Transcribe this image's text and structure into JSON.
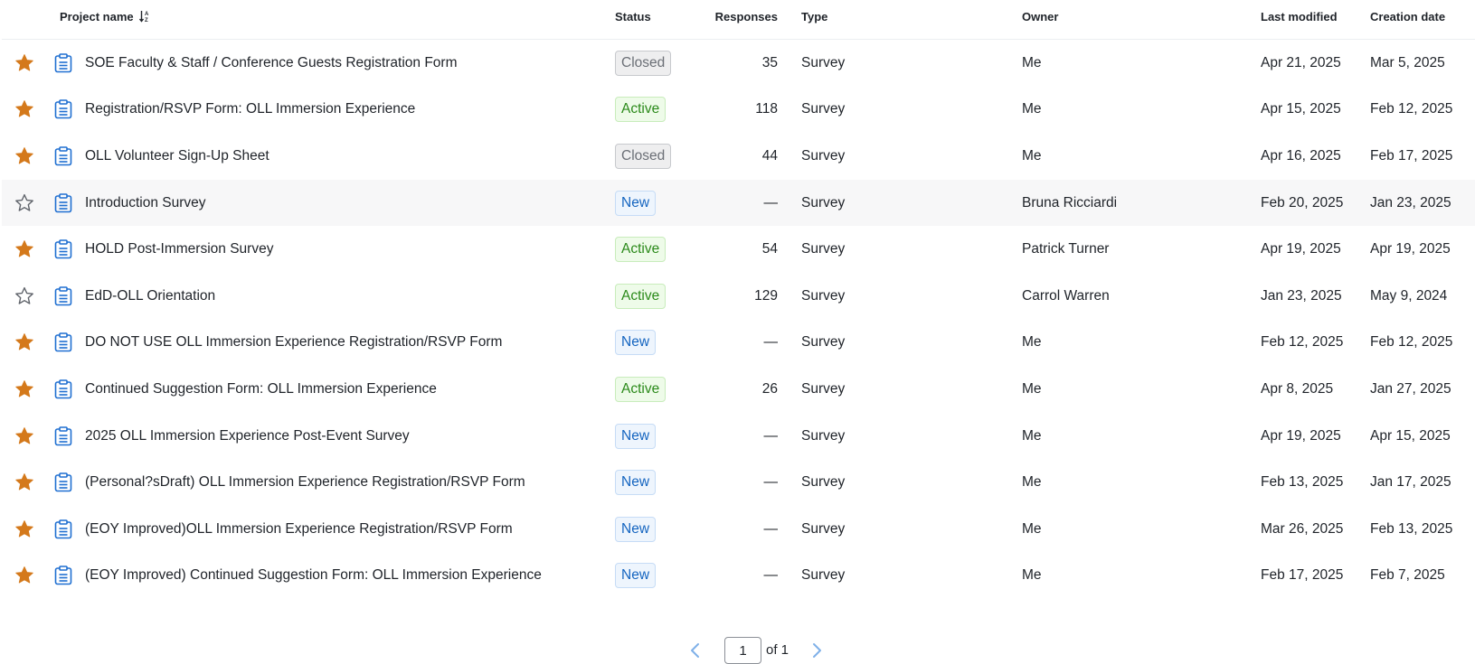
{
  "columns": {
    "project_name": "Project name",
    "status": "Status",
    "responses": "Responses",
    "type": "Type",
    "owner": "Owner",
    "last_modified": "Last modified",
    "creation_date": "Creation date"
  },
  "colors": {
    "star_filled": "#d4791b",
    "star_outline": "#5f636a",
    "doc_icon": "#1f6fd1",
    "pager_arrow": "#7fb0e8"
  },
  "rows": [
    {
      "starred": true,
      "name": "SOE Faculty & Staff / Conference Guests Registration Form",
      "status": "Closed",
      "responses": "35",
      "type": "Survey",
      "owner": "Me",
      "last_modified": "Apr 21, 2025",
      "created": "Mar 5, 2025"
    },
    {
      "starred": true,
      "name": "Registration/RSVP Form: OLL Immersion Experience",
      "status": "Active",
      "responses": "118",
      "type": "Survey",
      "owner": "Me",
      "last_modified": "Apr 15, 2025",
      "created": "Feb 12, 2025"
    },
    {
      "starred": true,
      "name": "OLL Volunteer Sign-Up Sheet",
      "status": "Closed",
      "responses": "44",
      "type": "Survey",
      "owner": "Me",
      "last_modified": "Apr 16, 2025",
      "created": "Feb 17, 2025"
    },
    {
      "starred": false,
      "name": "Introduction Survey",
      "status": "New",
      "responses": "—",
      "type": "Survey",
      "owner": "Bruna Ricciardi",
      "last_modified": "Feb 20, 2025",
      "created": "Jan 23, 2025"
    },
    {
      "starred": true,
      "name": "HOLD Post-Immersion Survey",
      "status": "Active",
      "responses": "54",
      "type": "Survey",
      "owner": "Patrick Turner",
      "last_modified": "Apr 19, 2025",
      "created": "Apr 19, 2025"
    },
    {
      "starred": false,
      "name": "EdD-OLL Orientation",
      "status": "Active",
      "responses": "129",
      "type": "Survey",
      "owner": "Carrol Warren",
      "last_modified": "Jan 23, 2025",
      "created": "May 9, 2024"
    },
    {
      "starred": true,
      "name": "DO NOT USE OLL Immersion Experience Registration/RSVP Form",
      "status": "New",
      "responses": "—",
      "type": "Survey",
      "owner": "Me",
      "last_modified": "Feb 12, 2025",
      "created": "Feb 12, 2025"
    },
    {
      "starred": true,
      "name": "Continued Suggestion Form: OLL Immersion Experience",
      "status": "Active",
      "responses": "26",
      "type": "Survey",
      "owner": "Me",
      "last_modified": "Apr 8, 2025",
      "created": "Jan 27, 2025"
    },
    {
      "starred": true,
      "name": "2025 OLL Immersion Experience Post-Event Survey",
      "status": "New",
      "responses": "—",
      "type": "Survey",
      "owner": "Me",
      "last_modified": "Apr 19, 2025",
      "created": "Apr 15, 2025"
    },
    {
      "starred": true,
      "name": "(Personal?sDraft) OLL Immersion Experience Registration/RSVP Form",
      "status": "New",
      "responses": "—",
      "type": "Survey",
      "owner": "Me",
      "last_modified": "Feb 13, 2025",
      "created": "Jan 17, 2025"
    },
    {
      "starred": true,
      "name": "(EOY Improved)OLL Immersion Experience Registration/RSVP Form",
      "status": "New",
      "responses": "—",
      "type": "Survey",
      "owner": "Me",
      "last_modified": "Mar 26, 2025",
      "created": "Feb 13, 2025"
    },
    {
      "starred": true,
      "name": "(EOY Improved) Continued Suggestion Form: OLL Immersion Experience",
      "status": "New",
      "responses": "—",
      "type": "Survey",
      "owner": "Me",
      "last_modified": "Feb 17, 2025",
      "created": "Feb 7, 2025"
    }
  ],
  "highlighted_row": 3,
  "pagination": {
    "current_page": "1",
    "of_label": "of 1"
  }
}
